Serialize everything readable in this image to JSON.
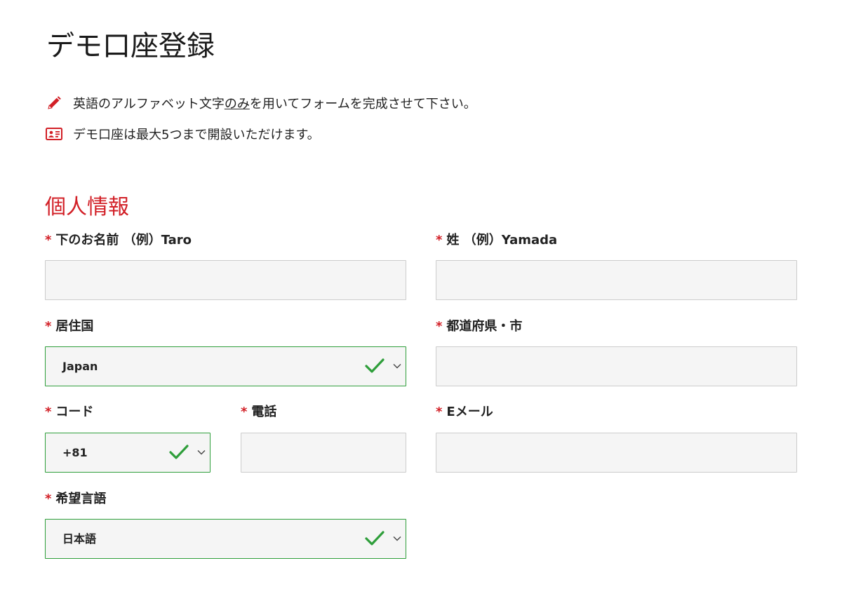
{
  "page": {
    "title": "デモ口座登録"
  },
  "notes": [
    {
      "icon": "pencil-icon",
      "prefix": "英語のアルファベット文字",
      "emphasis": "のみ",
      "suffix": "を用いてフォームを完成させて下さい。"
    },
    {
      "icon": "id-card-icon",
      "text": "デモ口座は最大5つまで開設いただけます。"
    }
  ],
  "section": {
    "title": "個人情報"
  },
  "colors": {
    "accent_red": "#d21f26",
    "valid_green": "#2e9e3a",
    "input_bg": "#f5f5f5",
    "input_border": "#cccccc"
  },
  "form": {
    "required_marker": "*",
    "first_name": {
      "label": "下のお名前 （例）Taro",
      "value": "",
      "placeholder": ""
    },
    "last_name": {
      "label": "姓 （例）Yamada",
      "value": "",
      "placeholder": ""
    },
    "country": {
      "label": "居住国",
      "value": "Japan",
      "valid": true
    },
    "city": {
      "label": "都道府県・市",
      "value": "",
      "placeholder": ""
    },
    "code": {
      "label": "コード",
      "value": "+81",
      "valid": true
    },
    "phone": {
      "label": "電話",
      "value": "",
      "placeholder": ""
    },
    "email": {
      "label": "Eメール",
      "value": "",
      "placeholder": ""
    },
    "language": {
      "label": "希望言語",
      "value": "日本語",
      "valid": true
    }
  }
}
